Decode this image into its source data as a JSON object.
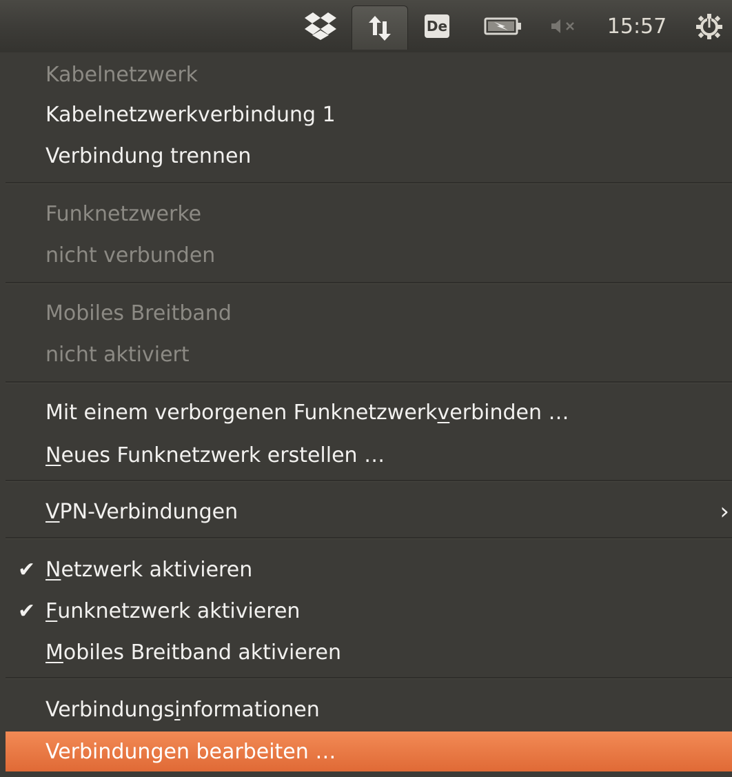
{
  "panel": {
    "icons": [
      "dropbox-icon",
      "network-updown-icon",
      "keyboard-layout-icon",
      "battery-charging-icon",
      "volume-muted-icon",
      "power-gear-icon"
    ],
    "keyboard_layout": "De",
    "clock": "15:57"
  },
  "menu": {
    "wired_header": "Kabelnetzwerk",
    "wired_connection": "Kabelnetzwerkverbindung 1",
    "disconnect": "Verbindung trennen",
    "wireless_header": "Funknetzwerke",
    "wireless_status": "nicht verbunden",
    "mobile_header": "Mobiles Breitband",
    "mobile_status": "nicht aktiviert",
    "hidden_network": {
      "pre": "Mit einem verborgenen Funknetzwerk ",
      "mnemonic": "v",
      "post": "erbinden …"
    },
    "new_network": {
      "pre": "",
      "mnemonic": "N",
      "post": "eues Funknetzwerk erstellen …"
    },
    "vpn": {
      "pre": "",
      "mnemonic": "V",
      "post": "PN-Verbindungen"
    },
    "enable_networking": {
      "pre": "",
      "mnemonic": "N",
      "post": "etzwerk aktivieren",
      "checked": true
    },
    "enable_wireless": {
      "pre": "",
      "mnemonic": "F",
      "post": "unknetzwerk aktivieren",
      "checked": true
    },
    "enable_mobile": {
      "pre": "",
      "mnemonic": "M",
      "post": "obiles Breitband aktivieren",
      "checked": false
    },
    "connection_info": {
      "pre": "Verbindungs",
      "mnemonic": "i",
      "post": "nformationen"
    },
    "edit_connections": "Verbindungen bearbeiten …",
    "check_mark": "✔",
    "submenu_arrow": "›"
  },
  "colors": {
    "panel_bg": "#3c3b37",
    "menu_bg": "#3c3b37",
    "text": "#f2f1ef",
    "disabled_text": "#8c8a84",
    "highlight": "#e8743e"
  }
}
